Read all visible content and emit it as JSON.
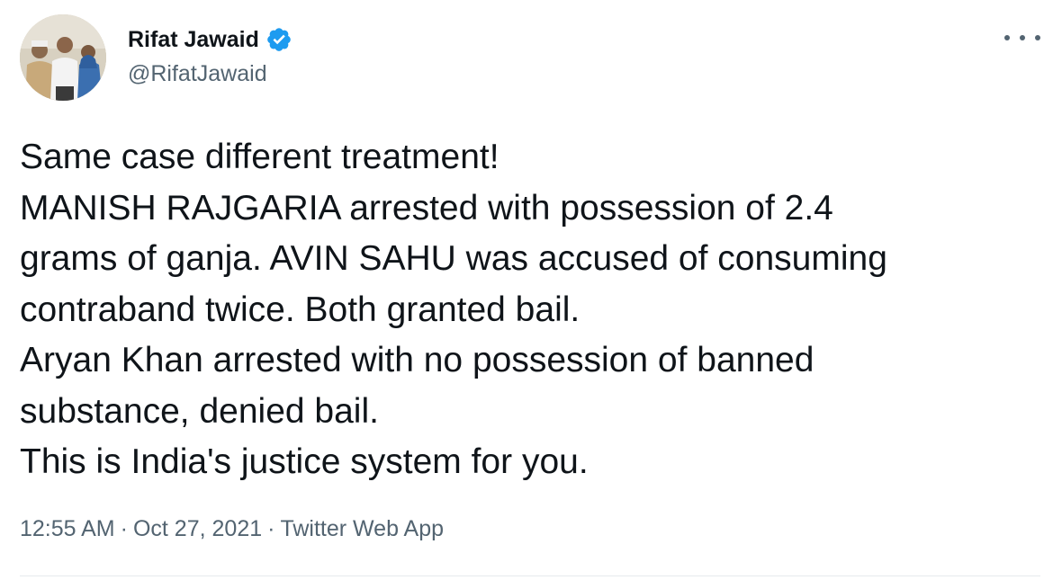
{
  "author": {
    "name": "Rifat Jawaid",
    "handle": "@RifatJawaid",
    "verified": true,
    "verified_icon": "verified-badge-icon",
    "avatar_icon": "profile-avatar"
  },
  "tweet": {
    "lines": [
      "Same case different treatment!",
      "MANISH RAJGARIA arrested with possession of 2.4",
      "grams of ganja. AVIN SAHU was accused of consuming",
      "contraband twice. Both granted bail.",
      "Aryan Khan arrested with no possession of banned",
      "substance, denied bail.",
      "This is India's justice system for you."
    ],
    "time": "12:55 AM",
    "separator": "·",
    "date": "Oct 27, 2021",
    "source": "Twitter Web App"
  },
  "menu": {
    "icon": "more-options-icon"
  },
  "colors": {
    "text": "#0f1419",
    "secondary": "#536471",
    "verified": "#1d9bf0",
    "divider": "#e6eaed"
  }
}
